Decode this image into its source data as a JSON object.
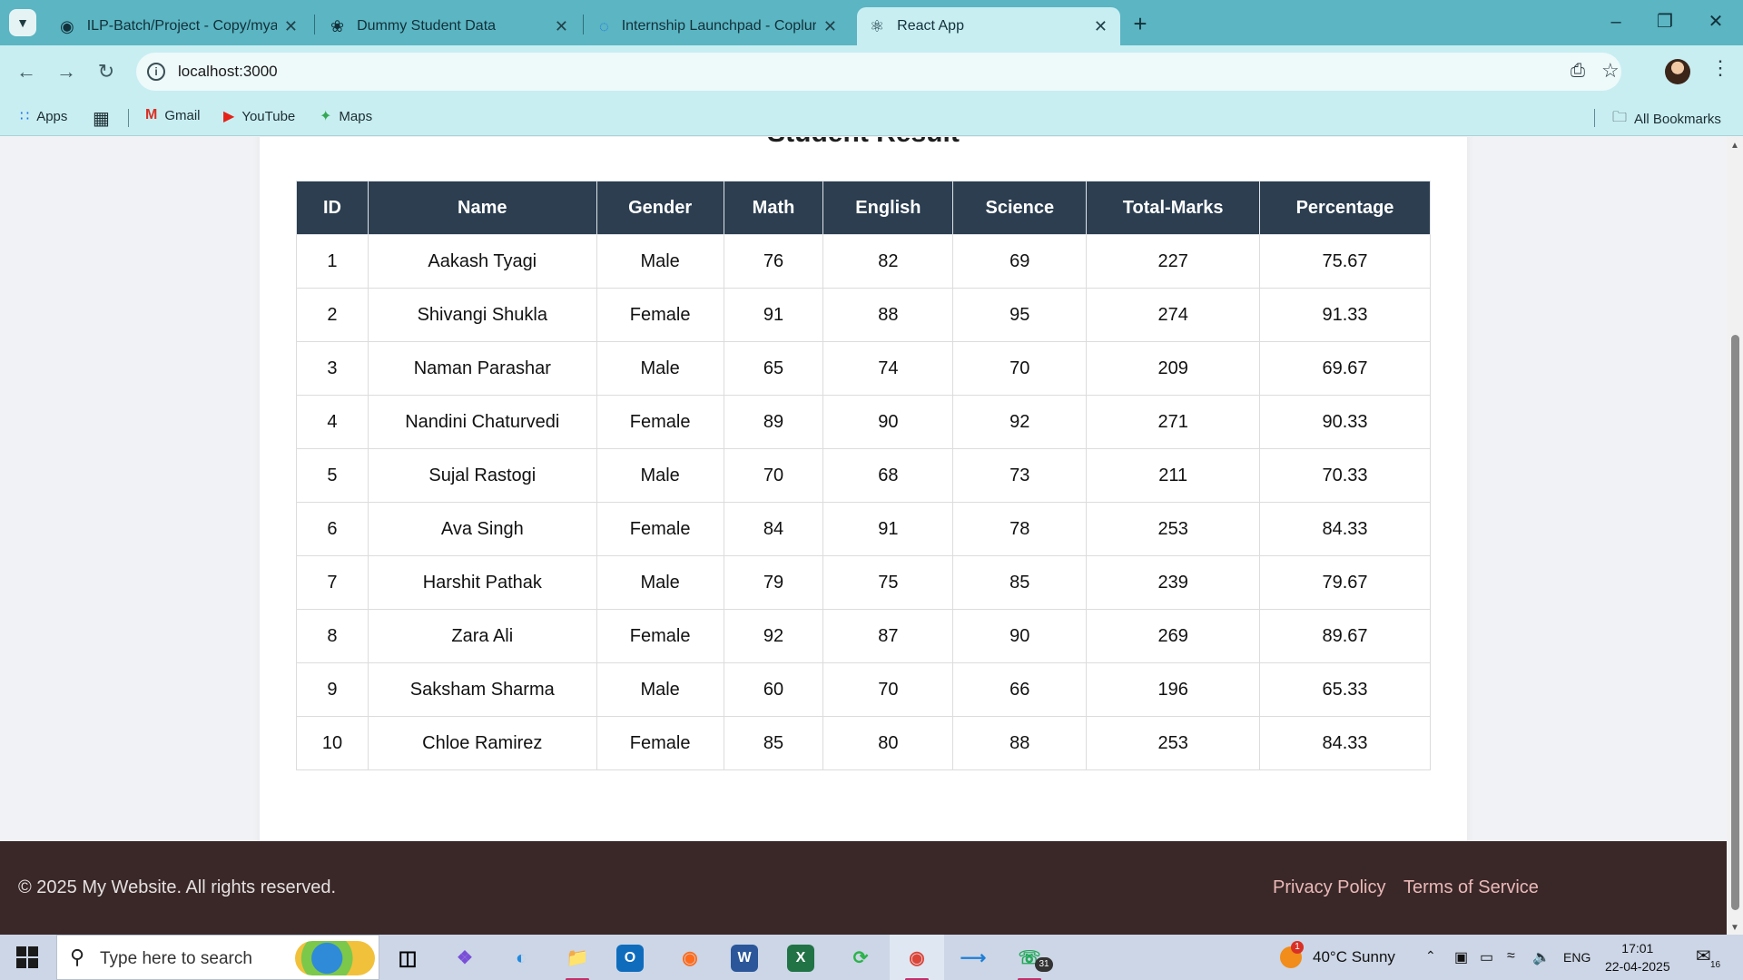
{
  "browser": {
    "tabs": [
      {
        "title": "ILP-Batch/Project - Copy/myapp",
        "icon": "github-icon"
      },
      {
        "title": "Dummy Student Data",
        "icon": "openai-icon"
      },
      {
        "title": "Internship Launchpad - Coplur",
        "icon": "loading-icon"
      },
      {
        "title": "React App",
        "icon": "react-icon"
      }
    ],
    "url": "localhost:3000",
    "bookmarks": {
      "apps": "Apps",
      "gmail": "Gmail",
      "youtube": "YouTube",
      "maps": "Maps",
      "all_bookmarks": "All Bookmarks"
    }
  },
  "page": {
    "title": "Student Result",
    "table": {
      "headers": [
        "ID",
        "Name",
        "Gender",
        "Math",
        "English",
        "Science",
        "Total-Marks",
        "Percentage"
      ],
      "rows": [
        [
          "1",
          "Aakash Tyagi",
          "Male",
          "76",
          "82",
          "69",
          "227",
          "75.67"
        ],
        [
          "2",
          "Shivangi Shukla",
          "Female",
          "91",
          "88",
          "95",
          "274",
          "91.33"
        ],
        [
          "3",
          "Naman Parashar",
          "Male",
          "65",
          "74",
          "70",
          "209",
          "69.67"
        ],
        [
          "4",
          "Nandini Chaturvedi",
          "Female",
          "89",
          "90",
          "92",
          "271",
          "90.33"
        ],
        [
          "5",
          "Sujal Rastogi",
          "Male",
          "70",
          "68",
          "73",
          "211",
          "70.33"
        ],
        [
          "6",
          "Ava Singh",
          "Female",
          "84",
          "91",
          "78",
          "253",
          "84.33"
        ],
        [
          "7",
          "Harshit Pathak",
          "Male",
          "79",
          "75",
          "85",
          "239",
          "79.67"
        ],
        [
          "8",
          "Zara Ali",
          "Female",
          "92",
          "87",
          "90",
          "269",
          "89.67"
        ],
        [
          "9",
          "Saksham Sharma",
          "Male",
          "60",
          "70",
          "66",
          "196",
          "65.33"
        ],
        [
          "10",
          "Chloe Ramirez",
          "Female",
          "85",
          "80",
          "88",
          "253",
          "84.33"
        ]
      ]
    },
    "footer": {
      "copyright": "© 2025 My Website. All rights reserved.",
      "privacy": "Privacy Policy",
      "terms": "Terms of Service"
    }
  },
  "taskbar": {
    "search_placeholder": "Type here to search",
    "weather": "40°C  Sunny",
    "weather_badge": "1",
    "whatsapp_badge": "31",
    "language": "ENG",
    "time": "17:01",
    "date": "22-04-2025",
    "notification_count": "16"
  },
  "colors": {
    "tab_bar": "#5bb5c2",
    "toolbar": "#c8eef2",
    "table_header": "#2c3e50",
    "footer": "#3a2828",
    "footer_link": "#eab8b8"
  }
}
